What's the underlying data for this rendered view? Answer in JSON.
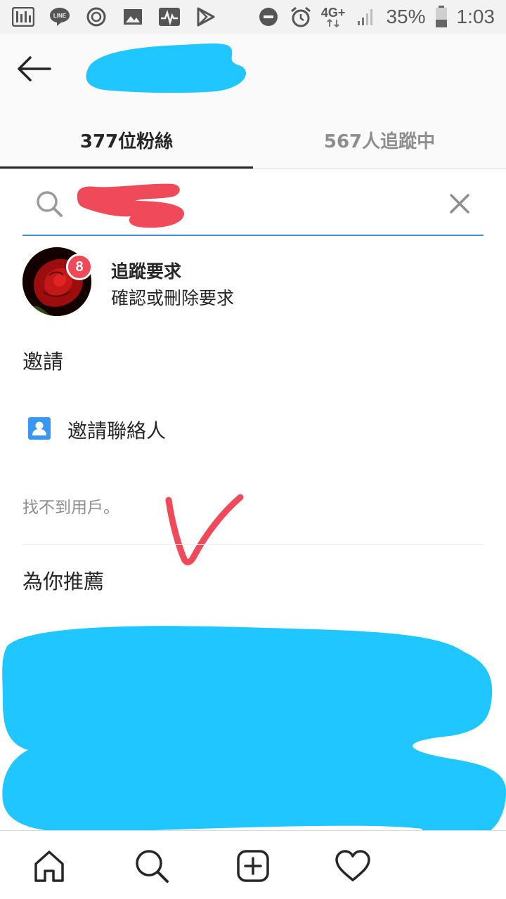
{
  "status_bar": {
    "battery": "35%",
    "time": "1:03",
    "network": "4G+",
    "icons_left": [
      "equalizer-icon",
      "line-app-icon",
      "camera-app-icon",
      "image-icon",
      "activity-icon",
      "play-store-icon"
    ],
    "icons_right": [
      "do-not-disturb-icon",
      "alarm-icon",
      "network-icon",
      "signal-icon",
      "battery-icon"
    ]
  },
  "header": {
    "back_icon": "arrow-left-icon",
    "tabs": [
      {
        "label": "377位粉絲",
        "active": true
      },
      {
        "label": "567人追蹤中",
        "active": false
      }
    ]
  },
  "search": {
    "placeholder": "",
    "search_icon": "search-icon",
    "clear_icon": "close-icon"
  },
  "follow_requests": {
    "badge": "8",
    "title": "追蹤要求",
    "subtitle": "確認或刪除要求"
  },
  "invite": {
    "heading": "邀請",
    "contacts_label": "邀請聯絡人"
  },
  "results": {
    "no_users": "找不到用戶。"
  },
  "recommended": {
    "heading": "為你推薦"
  },
  "bottom_nav": {
    "items": [
      "home-icon",
      "search-icon",
      "new-post-icon",
      "activity-heart-icon"
    ]
  },
  "colors": {
    "accent_blue": "#3f8fd2",
    "badge_red": "#ed4956",
    "redaction_blue": "#1fc6ff",
    "annotation_red": "#f04a5a",
    "text_primary": "#262626",
    "text_secondary": "#8e8e8e"
  }
}
